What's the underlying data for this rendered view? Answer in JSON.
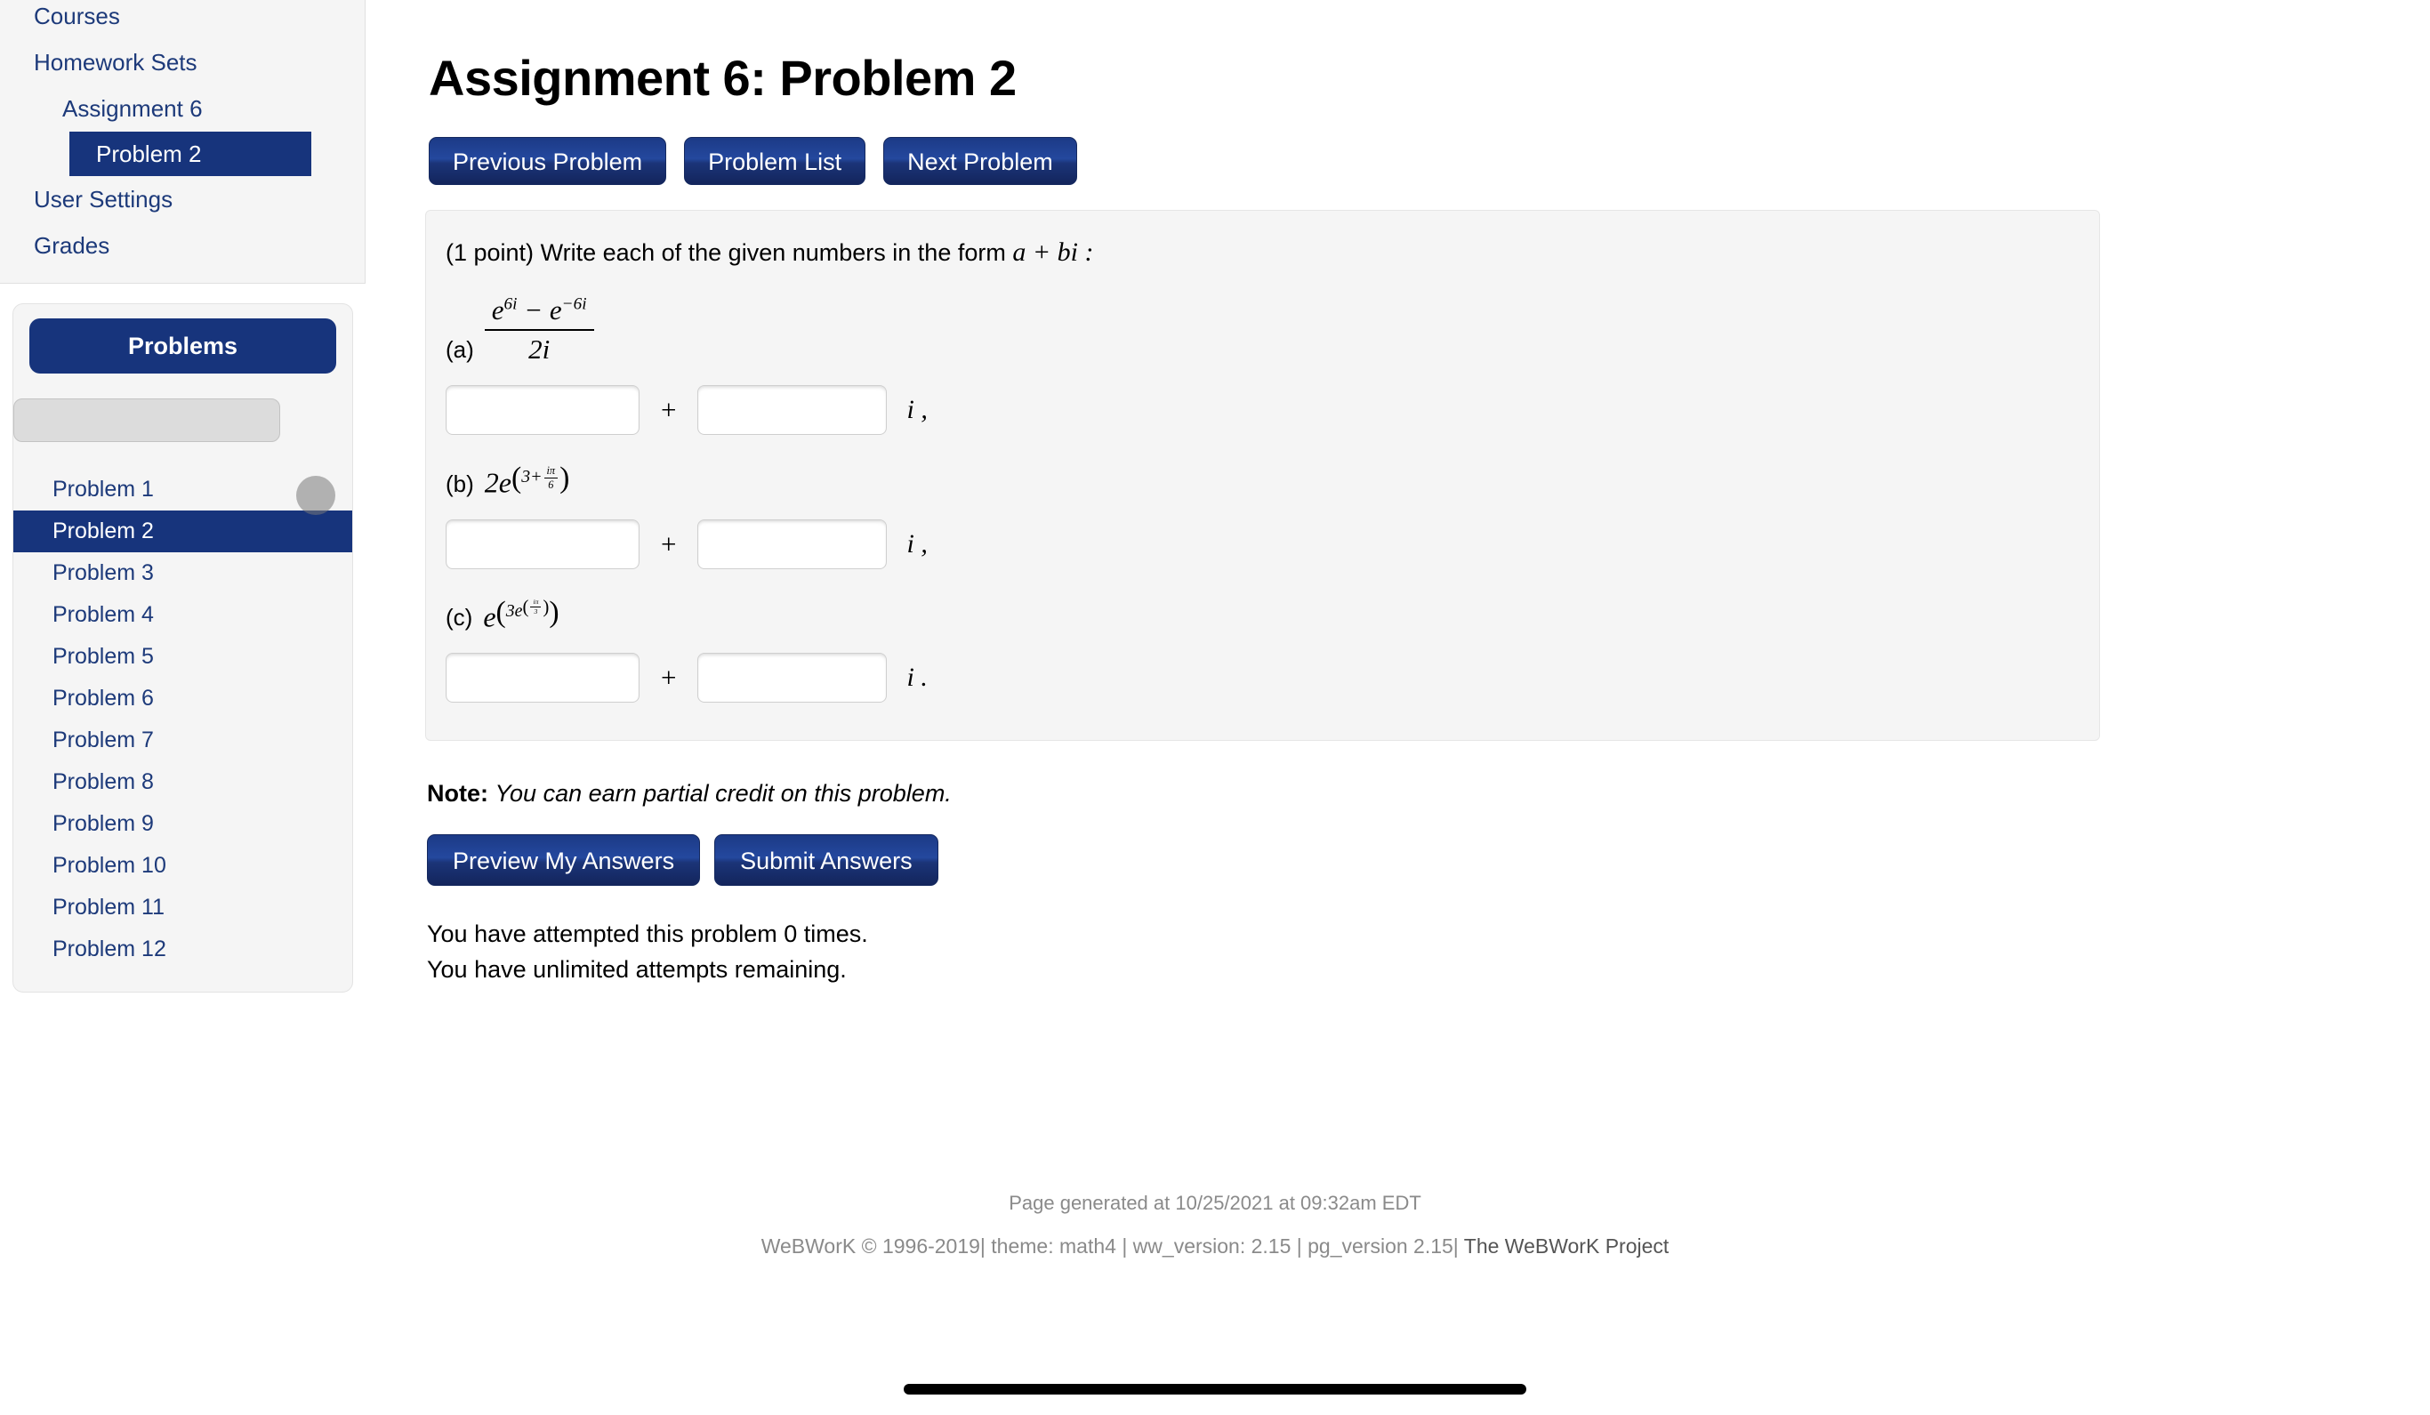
{
  "sidebar": {
    "nav": [
      {
        "label": "Courses",
        "level": 1,
        "active": false
      },
      {
        "label": "Homework Sets",
        "level": 1,
        "active": false
      },
      {
        "label": "Assignment 6",
        "level": 2,
        "active": false
      },
      {
        "label": "Problem 2",
        "level": 3,
        "active": true
      },
      {
        "label": "User Settings",
        "level": 1,
        "active": false
      },
      {
        "label": "Grades",
        "level": 1,
        "active": false
      }
    ],
    "problems_panel": {
      "header": "Problems",
      "search_value": "",
      "items": [
        {
          "label": "Problem 1",
          "active": false
        },
        {
          "label": "Problem 2",
          "active": true
        },
        {
          "label": "Problem 3",
          "active": false
        },
        {
          "label": "Problem 4",
          "active": false
        },
        {
          "label": "Problem 5",
          "active": false
        },
        {
          "label": "Problem 6",
          "active": false
        },
        {
          "label": "Problem 7",
          "active": false
        },
        {
          "label": "Problem 8",
          "active": false
        },
        {
          "label": "Problem 9",
          "active": false
        },
        {
          "label": "Problem 10",
          "active": false
        },
        {
          "label": "Problem 11",
          "active": false
        },
        {
          "label": "Problem 12",
          "active": false
        }
      ]
    }
  },
  "main": {
    "title": "Assignment 6: Problem 2",
    "nav_buttons": [
      {
        "label": "Previous Problem"
      },
      {
        "label": "Problem List"
      },
      {
        "label": "Next Problem"
      }
    ],
    "prompt": {
      "points": "(1 point)",
      "text": "Write each of the given numbers in the form",
      "form": "a + bi",
      "colon": ":"
    },
    "parts": [
      {
        "label": "(a)",
        "expression_tex": "(e^{6i} - e^{-6i}) / (2i)",
        "numerator_base1": "e",
        "numerator_exp1": "6i",
        "numerator_op": "−",
        "numerator_base2": "e",
        "numerator_exp2": "−6i",
        "denominator": "2i",
        "real_value": "",
        "imag_value": "",
        "plus": "+",
        "suffix": "i ,"
      },
      {
        "label": "(b)",
        "expression_tex": "2e^{(3 + i\\pi/6)}",
        "coefficient": "2e",
        "exp_lead": "3+",
        "exp_frac_num": "iπ",
        "exp_frac_den": "6",
        "real_value": "",
        "imag_value": "",
        "plus": "+",
        "suffix": "i ,"
      },
      {
        "label": "(c)",
        "expression_tex": "e^{(3e^{(i\\pi/3)})}",
        "base": "e",
        "inner_coefficient": "3e",
        "inner_frac_num": "iπ",
        "inner_frac_den": "3",
        "real_value": "",
        "imag_value": "",
        "plus": "+",
        "suffix": "i ."
      }
    ],
    "note": {
      "label": "Note:",
      "text": "You can earn partial credit on this problem."
    },
    "action_buttons": [
      {
        "label": "Preview My Answers"
      },
      {
        "label": "Submit Answers"
      }
    ],
    "attempts": {
      "line1": "You have attempted this problem 0 times.",
      "line2": "You have unlimited attempts remaining."
    }
  },
  "footer": {
    "generated": "Page generated at 10/25/2021 at 09:32am EDT",
    "copyright": "WeBWorK © 1996-2019| theme: math4 | ww_version: 2.15 | pg_version 2.15|",
    "project_link": "The WeBWorK Project"
  },
  "colors": {
    "accent_navy": "#17347c",
    "link_blue": "#1d3a7a",
    "panel_gray": "#f5f5f5"
  }
}
